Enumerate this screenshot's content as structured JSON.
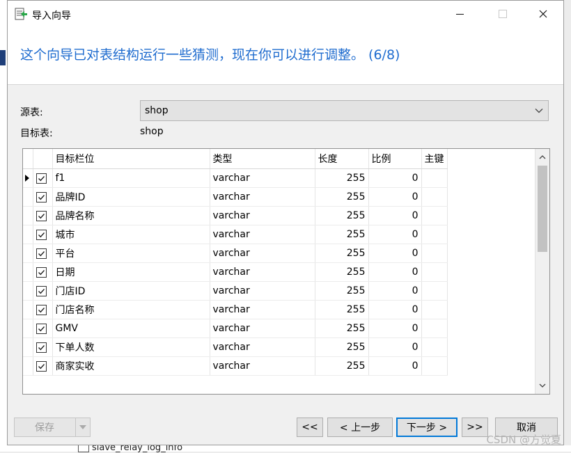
{
  "window": {
    "title": "导入向导"
  },
  "wizard": {
    "heading": "这个向导已对表结构运行一些猜测，现在你可以进行调整。 (6/8)"
  },
  "source": {
    "label": "源表:",
    "value": "shop"
  },
  "target": {
    "label": "目标表:",
    "value": "shop"
  },
  "grid": {
    "columns": [
      "目标栏位",
      "类型",
      "长度",
      "比例",
      "主键"
    ],
    "rows": [
      {
        "checked": true,
        "field": "f1",
        "type": "varchar",
        "length": "255",
        "scale": "0"
      },
      {
        "checked": true,
        "field": "品牌ID",
        "type": "varchar",
        "length": "255",
        "scale": "0"
      },
      {
        "checked": true,
        "field": "品牌名称",
        "type": "varchar",
        "length": "255",
        "scale": "0"
      },
      {
        "checked": true,
        "field": "城市",
        "type": "varchar",
        "length": "255",
        "scale": "0"
      },
      {
        "checked": true,
        "field": "平台",
        "type": "varchar",
        "length": "255",
        "scale": "0"
      },
      {
        "checked": true,
        "field": "日期",
        "type": "varchar",
        "length": "255",
        "scale": "0"
      },
      {
        "checked": true,
        "field": "门店ID",
        "type": "varchar",
        "length": "255",
        "scale": "0"
      },
      {
        "checked": true,
        "field": "门店名称",
        "type": "varchar",
        "length": "255",
        "scale": "0"
      },
      {
        "checked": true,
        "field": "GMV",
        "type": "varchar",
        "length": "255",
        "scale": "0"
      },
      {
        "checked": true,
        "field": "下单人数",
        "type": "varchar",
        "length": "255",
        "scale": "0"
      },
      {
        "checked": true,
        "field": "商家实收",
        "type": "varchar",
        "length": "255",
        "scale": "0"
      }
    ]
  },
  "buttons": {
    "save": "保存",
    "first": "<<",
    "prev": "< 上一步",
    "next": "下一步 >",
    "last": ">>",
    "cancel": "取消"
  },
  "background": {
    "tree_item": "slave_relay_log_info"
  },
  "watermark": "CSDN @方觉夏",
  "colors": {
    "heading": "#1f6ccf",
    "focus": "#0078d7"
  }
}
